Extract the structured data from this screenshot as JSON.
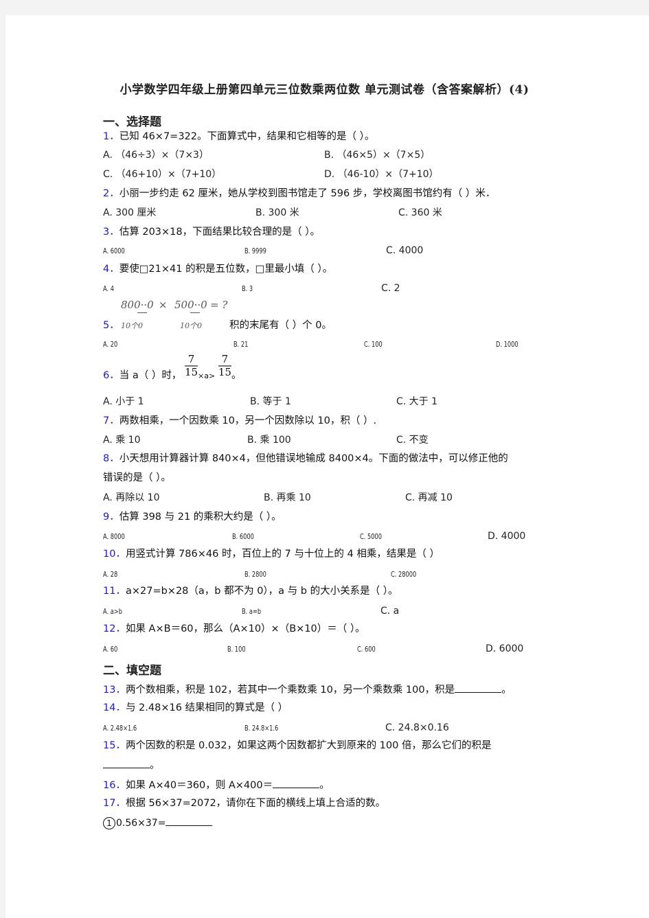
{
  "title": "小学数学四年级上册第四单元三位数乘两位数 单元测试卷（含答案解析）(4)",
  "sections": {
    "choice": "一、选择题",
    "fill": "二、填空题"
  },
  "questions": {
    "q1": {
      "num": "1．",
      "text": "已知 46×7=322。下面算式中，结果和它相等的是（   ）。",
      "options": [
        "A. （46÷3）×（7×3）",
        "B. （46×5）×（7×5）",
        "C. （46+10）×（7+10）",
        "D. （46-10）×（7+10）"
      ]
    },
    "q2": {
      "num": "2．",
      "text": "小丽一步约走 62 厘米，她从学校到图书馆走了 596 步，学校离图书馆约有（   ）米．",
      "options": [
        "A. 300 厘米",
        "B. 300 米",
        "C. 360 米"
      ]
    },
    "q3": {
      "num": "3．",
      "text": "估算 203×18，下面结果比较合理的是（   ）。",
      "options": [
        "A. 6000",
        "B. 9999",
        "C. 4000"
      ]
    },
    "q4": {
      "num": "4．",
      "text": "要使□21×41 的积是五位数，□里最小填（      ）。",
      "options": [
        "A. 4",
        "B. 3",
        "C. 2"
      ]
    },
    "q5": {
      "num": "5．",
      "img_left": "800··0",
      "img_times": "×",
      "img_right": "500··0",
      "img_eq": "= ?",
      "img_sub_left": "10个0",
      "img_sub_right": "10个0",
      "text": "积的末尾有（  ）个 0。",
      "options": [
        "A. 20",
        "B. 21",
        "C. 100",
        "D. 1000"
      ]
    },
    "q6": {
      "num": "6．",
      "text_before": "当 a（    ）时，",
      "frac_num": "7",
      "frac_den": "15",
      "mid": "×a>",
      "text_after": "。",
      "options": [
        "A. 小于 1",
        "B. 等于 1",
        "C. 大于 1"
      ]
    },
    "q7": {
      "num": "7．",
      "text": "两数相乘，一个因数乘 10，另一个因数除以 10，积（   ）.",
      "options": [
        "A. 乘 10",
        "B. 乘 100",
        "C. 不变"
      ]
    },
    "q8": {
      "num": "8．",
      "text_line1": "小天想用计算器计算  840×4，但他错误地输成  8400×4。下面的做法中，可以修正他的",
      "text_line2": "错误的是（    ）。",
      "options": [
        "A. 再除以 10",
        "B. 再乘 10",
        "C. 再减 10"
      ]
    },
    "q9": {
      "num": "9．",
      "text": "估算 398 与 21 的乘积大约是（   ）。",
      "options": [
        "A. 8000",
        "B. 6000",
        "C. 5000",
        "D.  4000"
      ]
    },
    "q10": {
      "num": "10．",
      "text": "用竖式计算 786×46 时，百位上的 7 与十位上的 4 相乘，结果是（   ）",
      "options": [
        "A. 28",
        "B. 2800",
        "C. 28000"
      ]
    },
    "q11": {
      "num": "11．",
      "text": "a×27=b×28（a，b 都不为 0），a 与 b 的大小关系是（   ）。",
      "options": [
        "A. a>b",
        "B. a=b",
        "C.  a"
      ]
    },
    "q12": {
      "num": "12．",
      "text": "如果 A×B＝60，那么（A×10）×（B×10）＝（    ）。",
      "options": [
        "A. 60",
        "B. 100",
        "C. 600",
        "D.  6000"
      ]
    },
    "q13": {
      "num": "13．",
      "text": "两个数相乘，积是 102，若其中一个乘数乘 10，另一个乘数乘 100，积是",
      "after": "。"
    },
    "q14": {
      "num": "14．",
      "text": "与 2.48×16 结果相同的算式是（  ）",
      "options": [
        "A. 2.48×1.6",
        "B. 24.8×1.6",
        "C.  24.8×0.16"
      ]
    },
    "q15": {
      "num": "15．",
      "text_line1": "两个因数的积是  0.032，如果这两个因数都扩大到原来的  100  倍，那么它们的积是",
      "after": "。"
    },
    "q16": {
      "num": "16．",
      "text": "如果 A×40＝360，则 A×400＝",
      "after": "。"
    },
    "q17": {
      "num": "17．",
      "text": "根据 56×37=2072，请你在下面的横线上填上合适的数。",
      "sub1_marker": "1",
      "sub1_text": "0.56×37="
    }
  }
}
